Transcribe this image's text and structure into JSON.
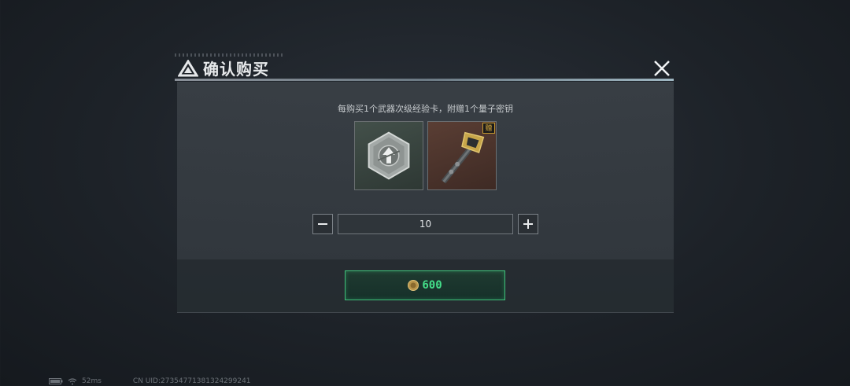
{
  "dialog": {
    "title": "确认购买",
    "notice": "每购买1个武器次级经验卡，附赠1个量子密钥",
    "items": [
      {
        "name": "武器次级经验卡",
        "icon": "exp-card-icon"
      },
      {
        "name": "量子密钥",
        "icon": "quantum-key-icon",
        "badge": "赠"
      }
    ],
    "quantity": "10",
    "minus_icon": "minus-icon",
    "plus_icon": "plus-icon",
    "price": "600",
    "currency_icon": "coin-icon",
    "close_icon": "close-icon"
  },
  "status_bar": {
    "latency": "52ms",
    "uid": "CN UID:27354771381324299241"
  },
  "colors": {
    "accent_green": "#44e08a",
    "badge_gold": "#e0b040"
  }
}
